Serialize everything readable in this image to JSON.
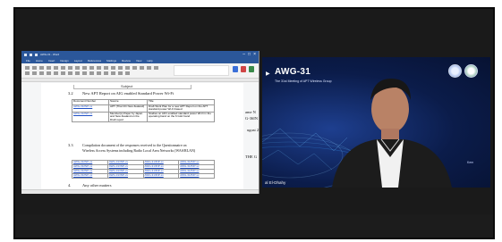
{
  "doc_window": {
    "title_text": "AWG-31 - Word",
    "menu_items": [
      "File",
      "Home",
      "Insert",
      "Design",
      "Layout",
      "References",
      "Mailings",
      "Review",
      "View",
      "Help"
    ],
    "header_cell": "Subject",
    "section_1": {
      "number": "3.2",
      "title": "New APT Report on AIG enabled Standard Power Wi-Fi"
    },
    "table_1": {
      "headers": [
        "Document Number",
        "Source",
        "Title"
      ],
      "rows": [
        [
          "AWG-31/INP-xx",
          "APT (Thai Chi New Zealand)",
          "Draft Work Plan for a new APT Report on the APT standard power Wi-Fi based"
        ],
        [
          "AWG-31/INP-xx",
          "Member(s) Paper by Japan and New Zealand on the Draft report",
          "Studies on AFC enabled standard power Wi-Fi in the operating band on the 6 GHz band"
        ]
      ]
    },
    "section_2": {
      "number": "3.3",
      "line_1": "Compilation document of the responses received to the Questionnaire on",
      "line_2": "Wireless Access Systems including Radio Local Area Networks (WAS/RLAN)"
    },
    "table_2": [
      [
        "AWG-31/INP-xx",
        "AWG-31/INP-xx",
        "AWG-31/INP-xx",
        "AWG-31/INP-xx"
      ],
      [
        "AWG-31/INP-xx",
        "AWG-31/INP-xx",
        "AWG-31/INP-xx",
        "AWG-31/INP-xx"
      ],
      [
        "AWG-31/INP-xx",
        "AWG-31/INP-xx",
        "AWG-31/INP-xx",
        "AWG-31/INP-xx"
      ],
      [
        "AWG-31/INP-xx",
        "AWG-31/INP-xx",
        "AWG-31/INP-xx",
        "AWG-31/INP-xx"
      ]
    ],
    "section_3": {
      "number": "4.",
      "title": "Any other matters"
    },
    "right_edge_text": {
      "line_1": "ame N",
      "line_2": "G-36IN",
      "line_3": "ugust 2",
      "line_4": "THE G"
    }
  },
  "video_tile": {
    "event_title": "AWG-31",
    "event_subtitle": "The 31st Meeting of APT Wireless Group",
    "participant_name": "al El-Dhahy",
    "corner_mark": "Kem",
    "accent_color": "#1e3f8f"
  }
}
